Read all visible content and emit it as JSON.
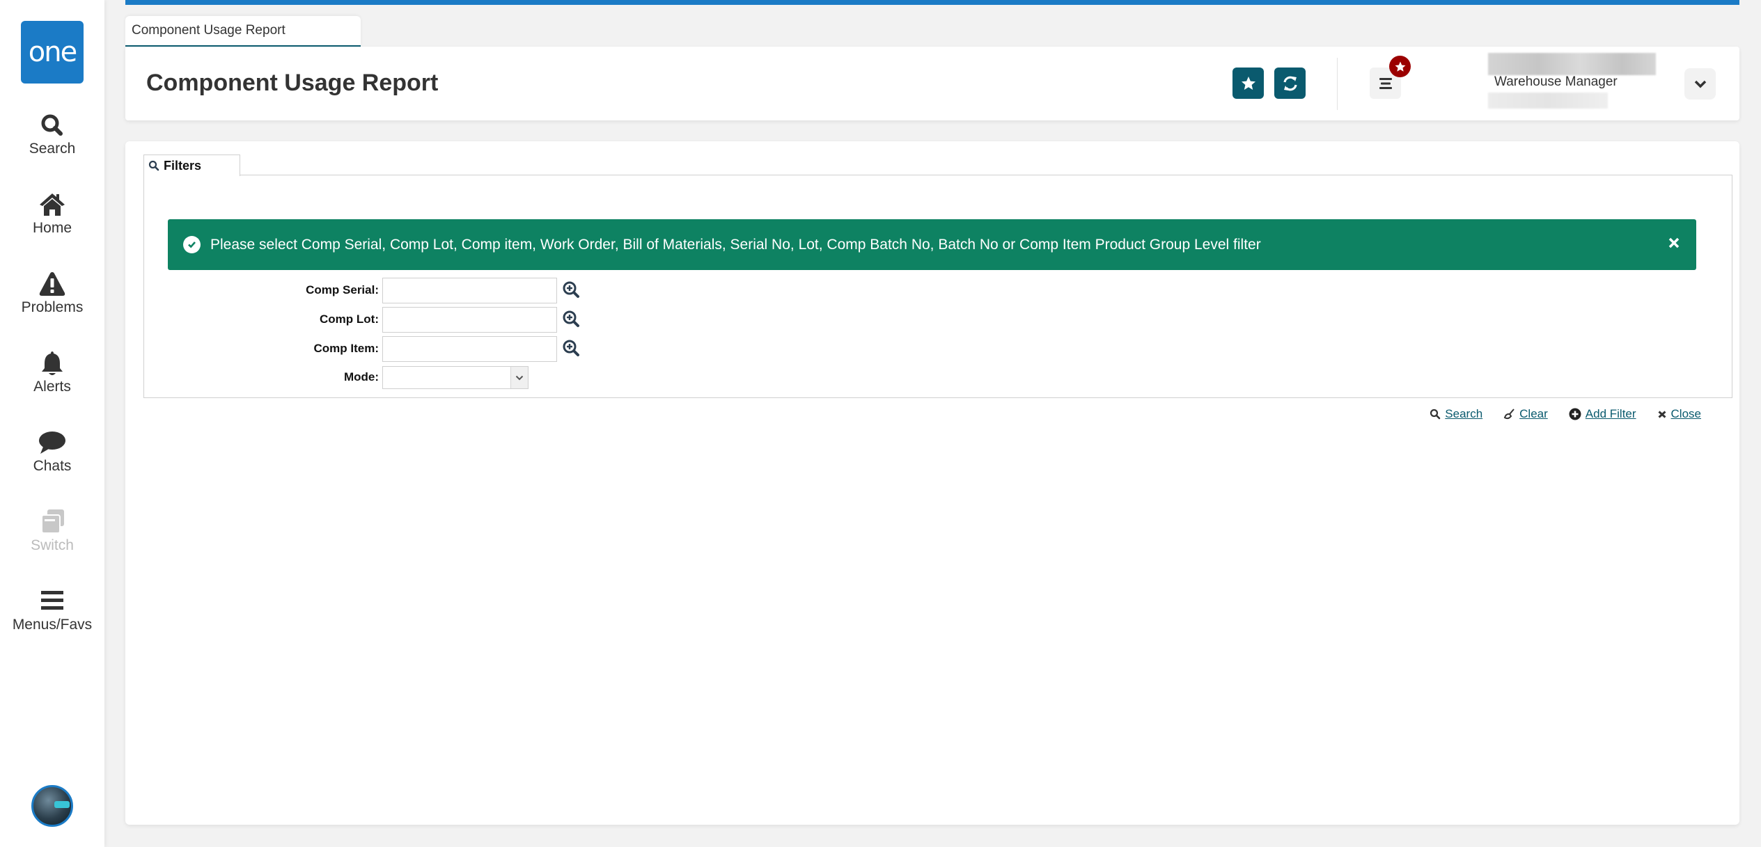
{
  "app": {
    "logo_text": "one"
  },
  "sidebar": {
    "items": [
      {
        "label": "Search",
        "icon": "search-icon"
      },
      {
        "label": "Home",
        "icon": "home-icon"
      },
      {
        "label": "Problems",
        "icon": "warning-icon"
      },
      {
        "label": "Alerts",
        "icon": "bell-icon"
      },
      {
        "label": "Chats",
        "icon": "chat-bubble-icon"
      },
      {
        "label": "Switch",
        "icon": "switch-windows-icon",
        "disabled": true
      },
      {
        "label": "Menus/Favs",
        "icon": "hamburger-menu-icon"
      }
    ]
  },
  "tabs": [
    {
      "label": "Component Usage Report",
      "active": true
    }
  ],
  "header": {
    "title": "Component Usage Report",
    "favorite_icon": "star-icon",
    "refresh_icon": "refresh-icon",
    "menu_icon": "list-menu-icon",
    "badge_icon": "star-icon",
    "user": {
      "role": "Warehouse Manager"
    }
  },
  "filters": {
    "tab_label": "Filters",
    "banner": {
      "message": "Please select Comp Serial, Comp Lot, Comp item, Work Order, Bill of Materials, Serial No, Lot, Comp Batch No, Batch No or Comp Item Product Group Level filter",
      "color": "#0e8262"
    },
    "fields": [
      {
        "label": "Comp Serial:",
        "value": "",
        "type": "lookup"
      },
      {
        "label": "Comp Lot:",
        "value": "",
        "type": "lookup"
      },
      {
        "label": "Comp Item:",
        "value": "",
        "type": "lookup"
      },
      {
        "label": "Mode:",
        "value": "",
        "type": "select"
      }
    ],
    "actions": {
      "search": "Search",
      "clear": "Clear",
      "add_filter": "Add Filter",
      "close": "Close"
    }
  },
  "colors": {
    "brand_blue": "#1b7bc6",
    "teal": "#0a5a6e",
    "badge_red": "#9b0000"
  }
}
